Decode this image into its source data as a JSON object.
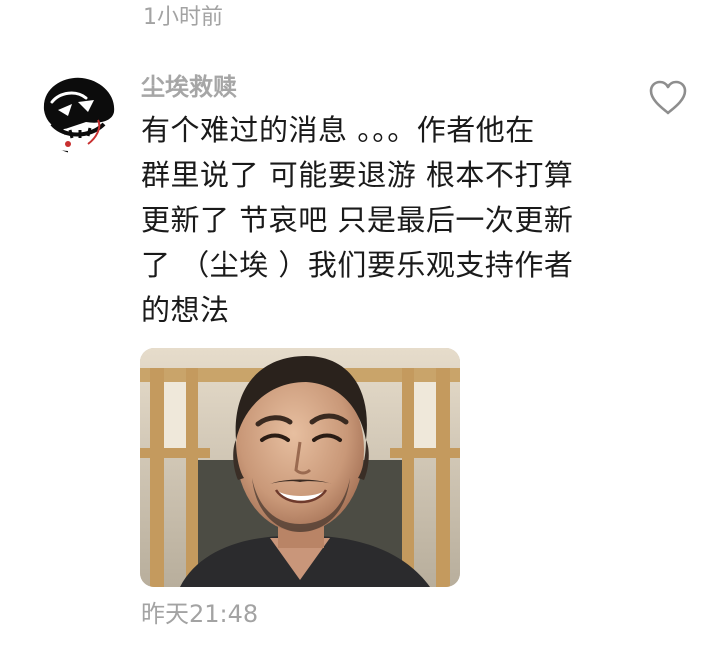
{
  "previous_comment": {
    "time": "1小时前"
  },
  "comment": {
    "username": "尘埃救赎",
    "text_lines": [
      "有个难过的消息 。。。作者他在",
      "群里说了 可能要退游 根本不打算",
      "更新了 节哀吧 只是最后一次更新",
      "了 （尘埃 ）我们要乐观支持作者",
      "的想法"
    ],
    "timestamp": "昨天21:48",
    "avatar_icon": "doodle-face-avatar",
    "like_icon": "heart-outline-icon",
    "image_icon": "smiling-man-photo"
  },
  "colors": {
    "muted_text": "#a3a3a3",
    "body_text": "#1a1a1a",
    "icon_gray": "#8e8e8e"
  }
}
